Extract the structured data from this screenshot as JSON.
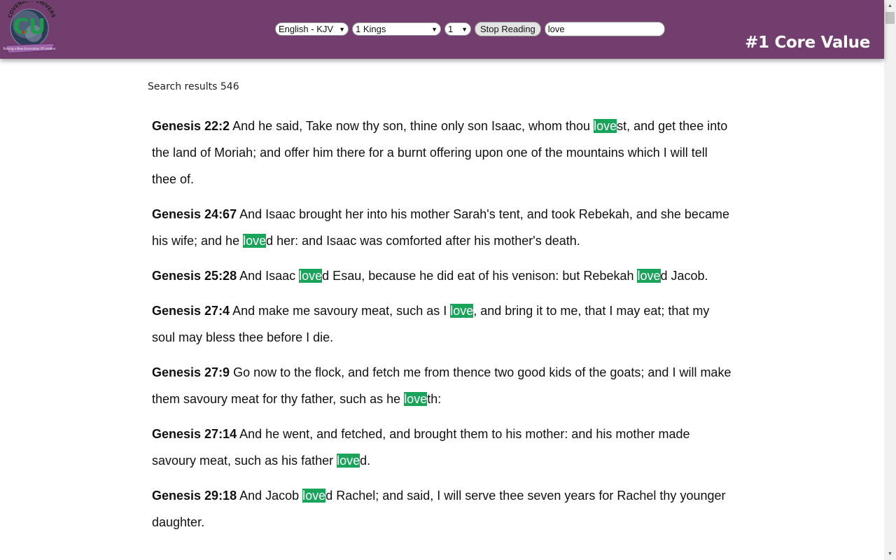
{
  "header": {
    "logo_alt": "Covenant University logo",
    "logo_text": "COVENANT UNIVERSITY",
    "logo_tagline": "Raising a New Generation Of Leaders",
    "core_value": "#1 Core Value",
    "bg_color": "#713e6e"
  },
  "controls": {
    "language_select": {
      "selected": "English - KJV"
    },
    "book_select": {
      "selected": "1 Kings"
    },
    "chapter_select": {
      "selected": "1"
    },
    "stop_reading_label": "Stop Reading",
    "search_value": "love"
  },
  "results": {
    "count_text": "Search results 546",
    "highlight_color": "#1aa35a",
    "verses": [
      {
        "ref": "Genesis 22:2",
        "segments": [
          {
            "t": " And he said, Take now thy son, thine only son Isaac, whom thou "
          },
          {
            "t": "love",
            "hl": true
          },
          {
            "t": "st, and get thee into the land of Moriah; and offer him there for a burnt offering upon one of the mountains which I will tell thee of."
          }
        ]
      },
      {
        "ref": "Genesis 24:67",
        "segments": [
          {
            "t": " And Isaac brought her into his mother Sarah's tent, and took Rebekah, and she became his wife; and he "
          },
          {
            "t": "love",
            "hl": true
          },
          {
            "t": "d her: and Isaac was comforted after his mother's death."
          }
        ]
      },
      {
        "ref": "Genesis 25:28",
        "segments": [
          {
            "t": " And Isaac "
          },
          {
            "t": "love",
            "hl": true
          },
          {
            "t": "d Esau, because he did eat of his venison: but Rebekah "
          },
          {
            "t": "love",
            "hl": true
          },
          {
            "t": "d Jacob."
          }
        ]
      },
      {
        "ref": "Genesis 27:4",
        "segments": [
          {
            "t": " And make me savoury meat, such as I "
          },
          {
            "t": "love",
            "hl": true
          },
          {
            "t": ", and bring it to me, that I may eat; that my soul may bless thee before I die."
          }
        ]
      },
      {
        "ref": "Genesis 27:9",
        "segments": [
          {
            "t": " Go now to the flock, and fetch me from thence two good kids of the goats; and I will make them savoury meat for thy father, such as he "
          },
          {
            "t": "love",
            "hl": true
          },
          {
            "t": "th:"
          }
        ]
      },
      {
        "ref": "Genesis 27:14",
        "segments": [
          {
            "t": " And he went, and fetched, and brought them to his mother: and his mother made savoury meat, such as his father "
          },
          {
            "t": "love",
            "hl": true
          },
          {
            "t": "d."
          }
        ]
      },
      {
        "ref": "Genesis 29:18",
        "segments": [
          {
            "t": " And Jacob "
          },
          {
            "t": "love",
            "hl": true
          },
          {
            "t": "d Rachel; and said, I will serve thee seven years for Rachel thy younger daughter."
          }
        ]
      }
    ]
  },
  "icons": {
    "dropdown_arrow": "▼",
    "scroll_up": "▲",
    "scroll_down": "▼"
  }
}
